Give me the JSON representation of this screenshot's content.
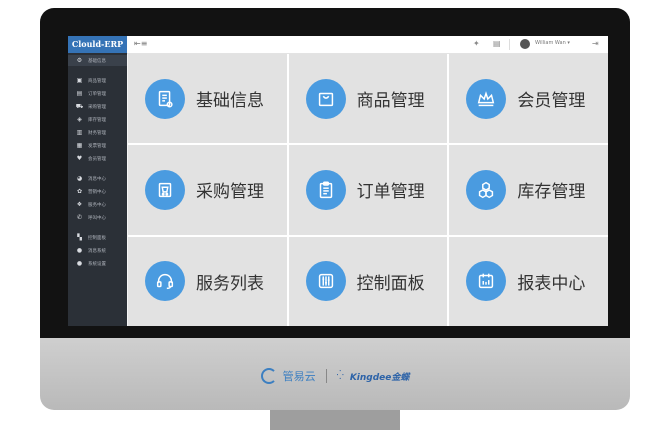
{
  "app": {
    "name": "Clould-ERP"
  },
  "header": {
    "user": "William Wan ▾"
  },
  "sidebar": {
    "items": [
      {
        "label": "基础信息",
        "icon": "gear-icon"
      },
      {
        "label": "商品管理",
        "icon": "box-icon"
      },
      {
        "label": "订单管理",
        "icon": "order-icon"
      },
      {
        "label": "采购管理",
        "icon": "truck-icon"
      },
      {
        "label": "库存管理",
        "icon": "stock-icon"
      },
      {
        "label": "财务管理",
        "icon": "wallet-icon"
      },
      {
        "label": "发票管理",
        "icon": "invoice-icon"
      },
      {
        "label": "会员管理",
        "icon": "member-icon"
      },
      {
        "label": "消息中心",
        "icon": "message-icon"
      },
      {
        "label": "营销中心",
        "icon": "marketing-icon"
      },
      {
        "label": "服务中心",
        "icon": "service-icon"
      },
      {
        "label": "呼叫中心",
        "icon": "phone-icon"
      },
      {
        "label": "控制面板",
        "icon": "control-icon"
      },
      {
        "label": "消息系统",
        "icon": "system-icon"
      },
      {
        "label": "系统设置",
        "icon": "settings-icon"
      }
    ]
  },
  "tiles": [
    {
      "label": "基础信息",
      "icon": "doc-icon"
    },
    {
      "label": "商品管理",
      "icon": "bag-icon"
    },
    {
      "label": "会员管理",
      "icon": "crown-icon"
    },
    {
      "label": "采购管理",
      "icon": "cart-icon"
    },
    {
      "label": "订单管理",
      "icon": "clipboard-icon"
    },
    {
      "label": "库存管理",
      "icon": "cubes-icon"
    },
    {
      "label": "服务列表",
      "icon": "headset-icon"
    },
    {
      "label": "控制面板",
      "icon": "sliders-icon"
    },
    {
      "label": "报表中心",
      "icon": "calendar-icon"
    }
  ],
  "footer": {
    "brand_cn": "管易云",
    "brand_en": "Kingdee金蝶"
  },
  "colors": {
    "accent": "#4a9be0",
    "sidebar_bg": "#2b3037",
    "logo_bg": "#3573b6",
    "tile_bg": "#e2e2e2"
  }
}
